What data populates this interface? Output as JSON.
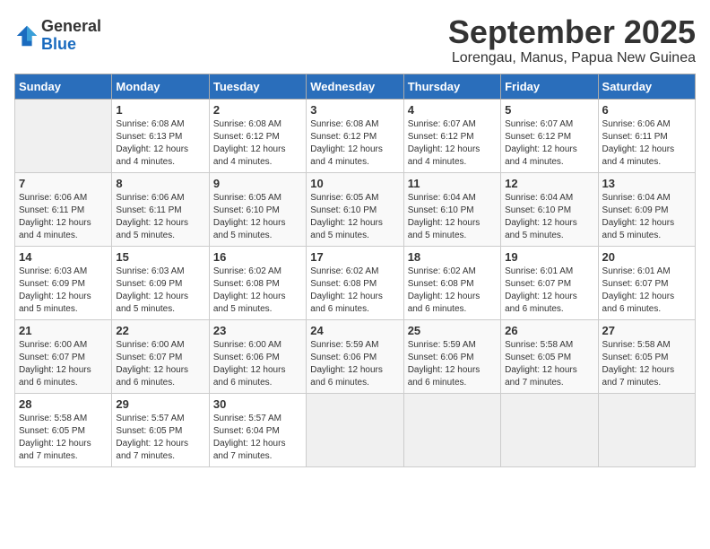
{
  "header": {
    "logo_general": "General",
    "logo_blue": "Blue",
    "month_title": "September 2025",
    "location": "Lorengau, Manus, Papua New Guinea"
  },
  "days_of_week": [
    "Sunday",
    "Monday",
    "Tuesday",
    "Wednesday",
    "Thursday",
    "Friday",
    "Saturday"
  ],
  "weeks": [
    [
      {
        "day": "",
        "sunrise": "",
        "sunset": "",
        "daylight": ""
      },
      {
        "day": "1",
        "sunrise": "Sunrise: 6:08 AM",
        "sunset": "Sunset: 6:13 PM",
        "daylight": "Daylight: 12 hours and 4 minutes."
      },
      {
        "day": "2",
        "sunrise": "Sunrise: 6:08 AM",
        "sunset": "Sunset: 6:12 PM",
        "daylight": "Daylight: 12 hours and 4 minutes."
      },
      {
        "day": "3",
        "sunrise": "Sunrise: 6:08 AM",
        "sunset": "Sunset: 6:12 PM",
        "daylight": "Daylight: 12 hours and 4 minutes."
      },
      {
        "day": "4",
        "sunrise": "Sunrise: 6:07 AM",
        "sunset": "Sunset: 6:12 PM",
        "daylight": "Daylight: 12 hours and 4 minutes."
      },
      {
        "day": "5",
        "sunrise": "Sunrise: 6:07 AM",
        "sunset": "Sunset: 6:12 PM",
        "daylight": "Daylight: 12 hours and 4 minutes."
      },
      {
        "day": "6",
        "sunrise": "Sunrise: 6:06 AM",
        "sunset": "Sunset: 6:11 PM",
        "daylight": "Daylight: 12 hours and 4 minutes."
      }
    ],
    [
      {
        "day": "7",
        "sunrise": "Sunrise: 6:06 AM",
        "sunset": "Sunset: 6:11 PM",
        "daylight": "Daylight: 12 hours and 4 minutes."
      },
      {
        "day": "8",
        "sunrise": "Sunrise: 6:06 AM",
        "sunset": "Sunset: 6:11 PM",
        "daylight": "Daylight: 12 hours and 5 minutes."
      },
      {
        "day": "9",
        "sunrise": "Sunrise: 6:05 AM",
        "sunset": "Sunset: 6:10 PM",
        "daylight": "Daylight: 12 hours and 5 minutes."
      },
      {
        "day": "10",
        "sunrise": "Sunrise: 6:05 AM",
        "sunset": "Sunset: 6:10 PM",
        "daylight": "Daylight: 12 hours and 5 minutes."
      },
      {
        "day": "11",
        "sunrise": "Sunrise: 6:04 AM",
        "sunset": "Sunset: 6:10 PM",
        "daylight": "Daylight: 12 hours and 5 minutes."
      },
      {
        "day": "12",
        "sunrise": "Sunrise: 6:04 AM",
        "sunset": "Sunset: 6:10 PM",
        "daylight": "Daylight: 12 hours and 5 minutes."
      },
      {
        "day": "13",
        "sunrise": "Sunrise: 6:04 AM",
        "sunset": "Sunset: 6:09 PM",
        "daylight": "Daylight: 12 hours and 5 minutes."
      }
    ],
    [
      {
        "day": "14",
        "sunrise": "Sunrise: 6:03 AM",
        "sunset": "Sunset: 6:09 PM",
        "daylight": "Daylight: 12 hours and 5 minutes."
      },
      {
        "day": "15",
        "sunrise": "Sunrise: 6:03 AM",
        "sunset": "Sunset: 6:09 PM",
        "daylight": "Daylight: 12 hours and 5 minutes."
      },
      {
        "day": "16",
        "sunrise": "Sunrise: 6:02 AM",
        "sunset": "Sunset: 6:08 PM",
        "daylight": "Daylight: 12 hours and 5 minutes."
      },
      {
        "day": "17",
        "sunrise": "Sunrise: 6:02 AM",
        "sunset": "Sunset: 6:08 PM",
        "daylight": "Daylight: 12 hours and 6 minutes."
      },
      {
        "day": "18",
        "sunrise": "Sunrise: 6:02 AM",
        "sunset": "Sunset: 6:08 PM",
        "daylight": "Daylight: 12 hours and 6 minutes."
      },
      {
        "day": "19",
        "sunrise": "Sunrise: 6:01 AM",
        "sunset": "Sunset: 6:07 PM",
        "daylight": "Daylight: 12 hours and 6 minutes."
      },
      {
        "day": "20",
        "sunrise": "Sunrise: 6:01 AM",
        "sunset": "Sunset: 6:07 PM",
        "daylight": "Daylight: 12 hours and 6 minutes."
      }
    ],
    [
      {
        "day": "21",
        "sunrise": "Sunrise: 6:00 AM",
        "sunset": "Sunset: 6:07 PM",
        "daylight": "Daylight: 12 hours and 6 minutes."
      },
      {
        "day": "22",
        "sunrise": "Sunrise: 6:00 AM",
        "sunset": "Sunset: 6:07 PM",
        "daylight": "Daylight: 12 hours and 6 minutes."
      },
      {
        "day": "23",
        "sunrise": "Sunrise: 6:00 AM",
        "sunset": "Sunset: 6:06 PM",
        "daylight": "Daylight: 12 hours and 6 minutes."
      },
      {
        "day": "24",
        "sunrise": "Sunrise: 5:59 AM",
        "sunset": "Sunset: 6:06 PM",
        "daylight": "Daylight: 12 hours and 6 minutes."
      },
      {
        "day": "25",
        "sunrise": "Sunrise: 5:59 AM",
        "sunset": "Sunset: 6:06 PM",
        "daylight": "Daylight: 12 hours and 6 minutes."
      },
      {
        "day": "26",
        "sunrise": "Sunrise: 5:58 AM",
        "sunset": "Sunset: 6:05 PM",
        "daylight": "Daylight: 12 hours and 7 minutes."
      },
      {
        "day": "27",
        "sunrise": "Sunrise: 5:58 AM",
        "sunset": "Sunset: 6:05 PM",
        "daylight": "Daylight: 12 hours and 7 minutes."
      }
    ],
    [
      {
        "day": "28",
        "sunrise": "Sunrise: 5:58 AM",
        "sunset": "Sunset: 6:05 PM",
        "daylight": "Daylight: 12 hours and 7 minutes."
      },
      {
        "day": "29",
        "sunrise": "Sunrise: 5:57 AM",
        "sunset": "Sunset: 6:05 PM",
        "daylight": "Daylight: 12 hours and 7 minutes."
      },
      {
        "day": "30",
        "sunrise": "Sunrise: 5:57 AM",
        "sunset": "Sunset: 6:04 PM",
        "daylight": "Daylight: 12 hours and 7 minutes."
      },
      {
        "day": "",
        "sunrise": "",
        "sunset": "",
        "daylight": ""
      },
      {
        "day": "",
        "sunrise": "",
        "sunset": "",
        "daylight": ""
      },
      {
        "day": "",
        "sunrise": "",
        "sunset": "",
        "daylight": ""
      },
      {
        "day": "",
        "sunrise": "",
        "sunset": "",
        "daylight": ""
      }
    ]
  ]
}
